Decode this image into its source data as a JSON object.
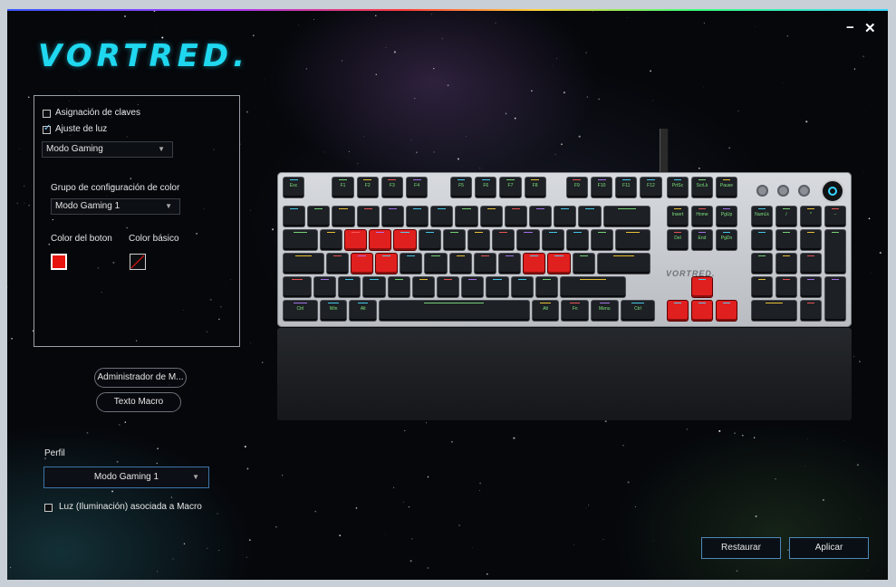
{
  "window": {
    "logo": "VORTRED.",
    "minimize_icon": "−",
    "close_icon": "✕"
  },
  "lighting_panel": {
    "key_assignment_label": "Asignación de claves",
    "key_assignment_checked": false,
    "light_setting_label": "Ajuste de luz",
    "light_setting_checked": true,
    "mode_select_value": "Modo Gaming",
    "color_group_label": "Grupo de configuración de color",
    "color_group_value": "Modo Gaming 1",
    "button_color_label": "Color del boton",
    "basic_color_label": "Color básico",
    "button_color": "#e8140f",
    "basic_color": "none"
  },
  "macro": {
    "manager_label": "Administrador de M...",
    "text_macro_label": "Texto Macro"
  },
  "profile": {
    "label": "Perfil",
    "value": "Modo Gaming 1",
    "macro_light_label": "Luz (Iluminación) asociada a Macro",
    "macro_light_checked": false
  },
  "footer": {
    "restore_label": "Restaurar",
    "apply_label": "Aplicar"
  },
  "keyboard": {
    "brand": "VORTRED.",
    "accent_color": "#1fd8f0",
    "highlight_color": "#e0201f",
    "fn_row": [
      "Esc",
      "F1",
      "F2",
      "F3",
      "F4",
      "F5",
      "F6",
      "F7",
      "F8",
      "F9",
      "F10",
      "F11",
      "F12"
    ],
    "nav_top": [
      "PrtSc",
      "ScrLk",
      "Pause"
    ],
    "nav_mid": [
      "Insert",
      "Home",
      "PgUp"
    ],
    "nav_bot": [
      "Del",
      "End",
      "PgDn"
    ],
    "bottom_row": [
      "Ctrl",
      "Win",
      "Alt",
      "",
      "Alt",
      "Fn",
      "Menu",
      "Ctrl"
    ],
    "numpad_top": [
      "NumLk",
      "/",
      "*",
      "−"
    ],
    "red_keys": [
      "W",
      "A",
      "S",
      "D",
      "K",
      "L",
      "Up",
      "Left",
      "Down",
      "Right"
    ]
  }
}
